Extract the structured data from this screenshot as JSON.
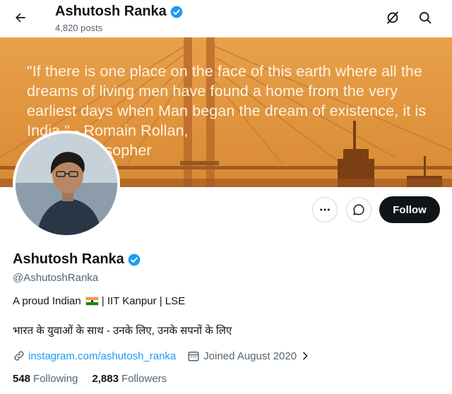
{
  "header": {
    "name": "Ashutosh Ranka",
    "posts": "4,820 posts",
    "icons": [
      "back-arrow-icon",
      "grok-icon",
      "search-icon"
    ]
  },
  "banner": {
    "quote": "\"If there is one place on the face of this earth where all the dreams of living men have found a home from the very earliest days when Man began the dream of existence, it is India.\" - Romain Rollan,",
    "quote_tail": "Philosopher",
    "colors": {
      "sky": "#e39a3e",
      "bridge": "#8a4a17",
      "text": "#fff3df"
    }
  },
  "actions": {
    "more_icon": "more-icon",
    "message_icon": "message-icon",
    "follow_label": "Follow"
  },
  "profile": {
    "name": "Ashutosh Ranka",
    "handle": "@AshutoshRanka",
    "bio_prefix": "A proud Indian",
    "bio_suffix": "| IIT Kanpur | LSE",
    "bio_hindi": "भारत के युवाओं के साथ - उनके लिए, उनके सपनों के लिए",
    "link": "instagram.com/ashutosh_ranka",
    "joined": "Joined August 2020",
    "following_count": "548",
    "following_label": "Following",
    "followers_count": "2,883",
    "followers_label": "Followers"
  },
  "colors": {
    "verified": "#1d9bf0",
    "link": "#1d9bf0",
    "muted": "#536471",
    "text": "#0f1419"
  }
}
